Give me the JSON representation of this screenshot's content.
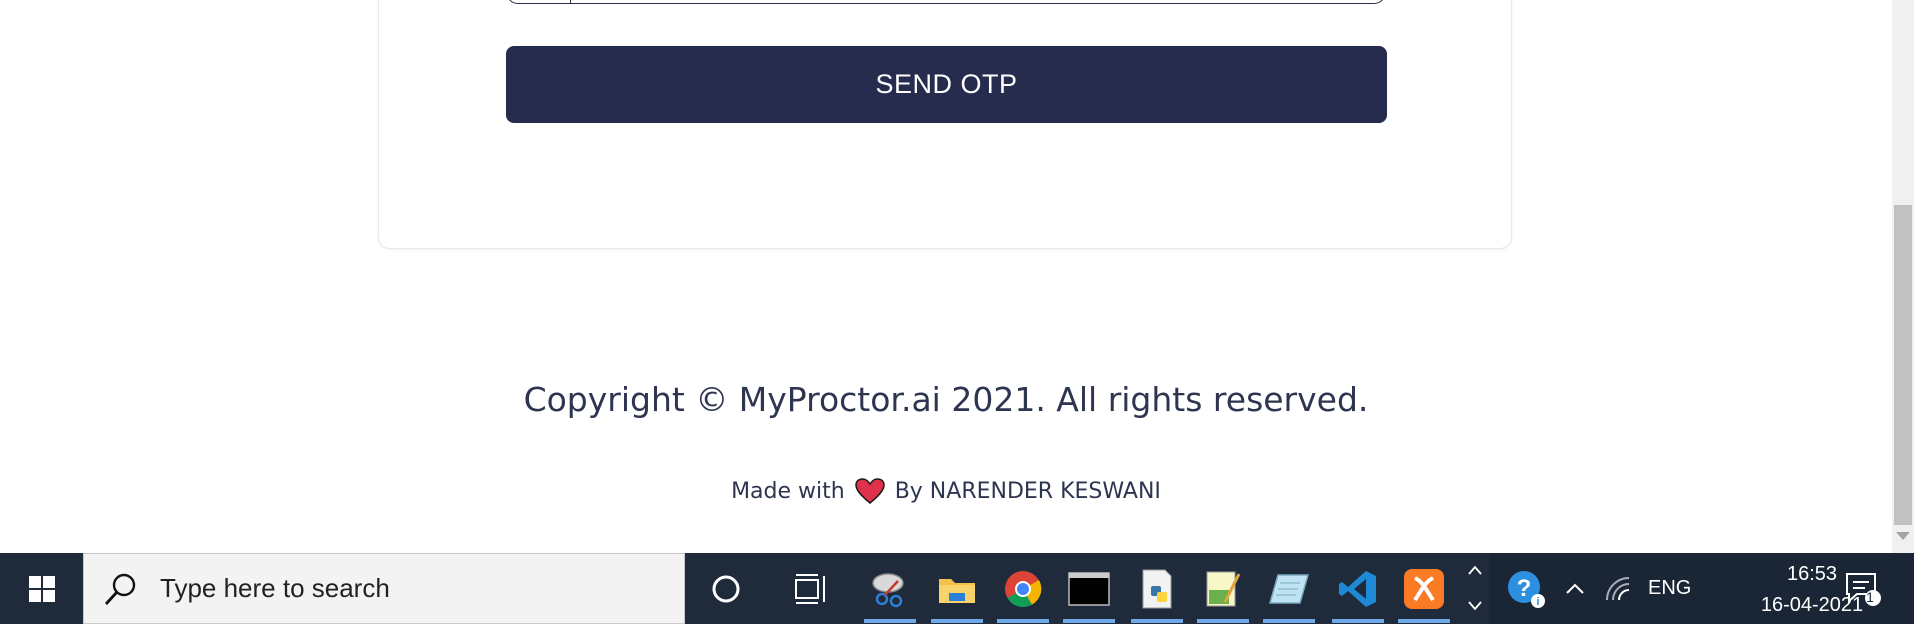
{
  "form": {
    "send_otp_label": "SEND OTP"
  },
  "footer": {
    "copyright": "Copyright © MyProctor.ai 2021. All rights reserved.",
    "made_with_prefix": "Made with",
    "made_with_suffix": "By NARENDER KESWANI"
  },
  "taskbar": {
    "search_placeholder": "Type here to search",
    "language": "ENG",
    "time": "16:53",
    "date": "16-04-2021",
    "notification_count": "1",
    "pinned_apps": [
      "snipping-tool-icon",
      "file-explorer-icon",
      "chrome-icon",
      "terminal-icon",
      "python-idle-icon",
      "notepad-plus-icon",
      "editor-icon",
      "vscode-icon",
      "xampp-icon"
    ]
  },
  "colors": {
    "button_bg": "#262c4d",
    "text": "#2e3550",
    "taskbar": "#1f2b3a",
    "heart": "#e0314b"
  }
}
